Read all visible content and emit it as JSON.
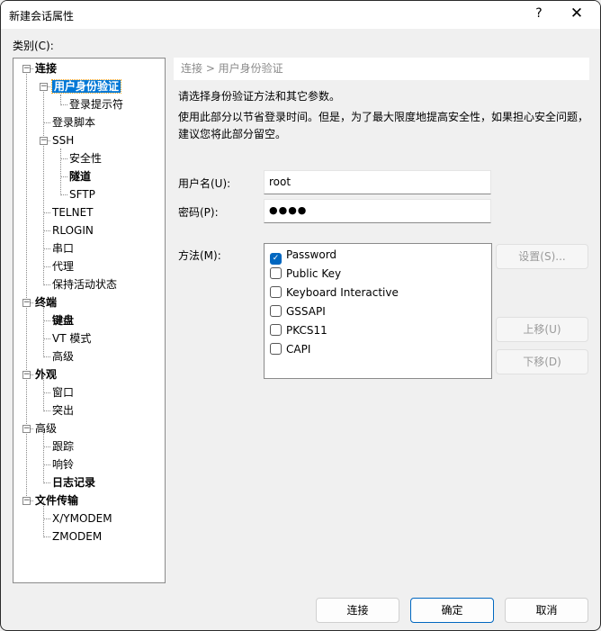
{
  "window": {
    "title": "新建会话属性",
    "help_label": "?",
    "close_label": "✕"
  },
  "category_label": "类别(C):",
  "tree": {
    "items": [
      {
        "label": "连接",
        "level": 0,
        "bold": true,
        "expander": "−"
      },
      {
        "label": "用户身份验证",
        "level": 1,
        "bold": true,
        "expander": "−",
        "selected": true
      },
      {
        "label": "登录提示符",
        "level": 2,
        "bold": false
      },
      {
        "label": "登录脚本",
        "level": 1,
        "bold": false
      },
      {
        "label": "SSH",
        "level": 1,
        "bold": false,
        "expander": "−"
      },
      {
        "label": "安全性",
        "level": 2,
        "bold": false
      },
      {
        "label": "隧道",
        "level": 2,
        "bold": true
      },
      {
        "label": "SFTP",
        "level": 2,
        "bold": false
      },
      {
        "label": "TELNET",
        "level": 1,
        "bold": false
      },
      {
        "label": "RLOGIN",
        "level": 1,
        "bold": false
      },
      {
        "label": "串口",
        "level": 1,
        "bold": false
      },
      {
        "label": "代理",
        "level": 1,
        "bold": false
      },
      {
        "label": "保持活动状态",
        "level": 1,
        "bold": false
      },
      {
        "label": "终端",
        "level": 0,
        "bold": true,
        "expander": "−"
      },
      {
        "label": "键盘",
        "level": 1,
        "bold": true
      },
      {
        "label": "VT 模式",
        "level": 1,
        "bold": false
      },
      {
        "label": "高级",
        "level": 1,
        "bold": false
      },
      {
        "label": "外观",
        "level": 0,
        "bold": true,
        "expander": "−"
      },
      {
        "label": "窗口",
        "level": 1,
        "bold": false
      },
      {
        "label": "突出",
        "level": 1,
        "bold": false
      },
      {
        "label": "高级",
        "level": 0,
        "bold": false,
        "expander": "−"
      },
      {
        "label": "跟踪",
        "level": 1,
        "bold": false
      },
      {
        "label": "响铃",
        "level": 1,
        "bold": false
      },
      {
        "label": "日志记录",
        "level": 1,
        "bold": true
      },
      {
        "label": "文件传输",
        "level": 0,
        "bold": true,
        "expander": "−"
      },
      {
        "label": "X/YMODEM",
        "level": 1,
        "bold": false
      },
      {
        "label": "ZMODEM",
        "level": 1,
        "bold": false
      }
    ]
  },
  "panel": {
    "breadcrumb": "连接 > 用户身份验证",
    "description_1": "请选择身份验证方法和其它参数。",
    "description_2": "使用此部分以节省登录时间。但是，为了最大限度地提高安全性，如果担心安全问题，建议您将此部分留空。",
    "username_label": "用户名(U):",
    "username_value": "root",
    "password_label": "密码(P):",
    "password_value": "●●●●",
    "method_label": "方法(M):",
    "methods": [
      {
        "label": "Password",
        "checked": true
      },
      {
        "label": "Public Key",
        "checked": false
      },
      {
        "label": "Keyboard Interactive",
        "checked": false
      },
      {
        "label": "GSSAPI",
        "checked": false
      },
      {
        "label": "PKCS11",
        "checked": false
      },
      {
        "label": "CAPI",
        "checked": false
      }
    ],
    "settings_button": "设置(S)...",
    "move_up_button": "上移(U)",
    "move_down_button": "下移(D)"
  },
  "footer": {
    "connect_button": "连接",
    "ok_button": "确定",
    "cancel_button": "取消"
  }
}
